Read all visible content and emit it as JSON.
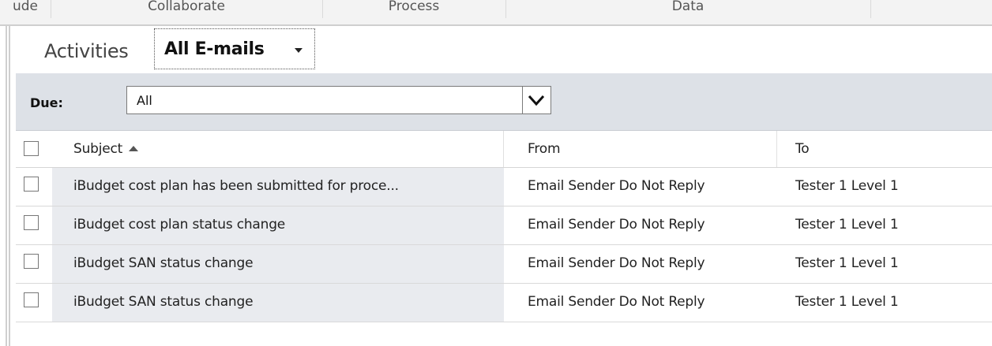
{
  "ribbon": {
    "groups": [
      "ude",
      "Collaborate",
      "Process",
      "Data"
    ]
  },
  "view": {
    "header_title": "Activities",
    "selector_label": "All E-mails"
  },
  "filter": {
    "due_label": "Due:",
    "due_value": "All"
  },
  "grid": {
    "columns": {
      "subject": "Subject",
      "from": "From",
      "to": "To"
    },
    "sort": {
      "column": "Subject",
      "direction": "ascending"
    },
    "rows": [
      {
        "subject": "iBudget cost plan has been submitted for proce...",
        "from": "Email Sender Do Not Reply",
        "to": "Tester 1 Level 1"
      },
      {
        "subject": "iBudget cost plan status change",
        "from": "Email Sender Do Not Reply",
        "to": "Tester 1 Level 1"
      },
      {
        "subject": "iBudget SAN status change",
        "from": "Email Sender Do Not Reply",
        "to": "Tester 1 Level 1"
      },
      {
        "subject": "iBudget SAN status change",
        "from": "Email Sender Do Not Reply",
        "to": "Tester 1 Level 1"
      }
    ]
  },
  "colors": {
    "filter_bar_bg": "#dde1e7",
    "subject_cell_bg": "#e9ebef"
  }
}
